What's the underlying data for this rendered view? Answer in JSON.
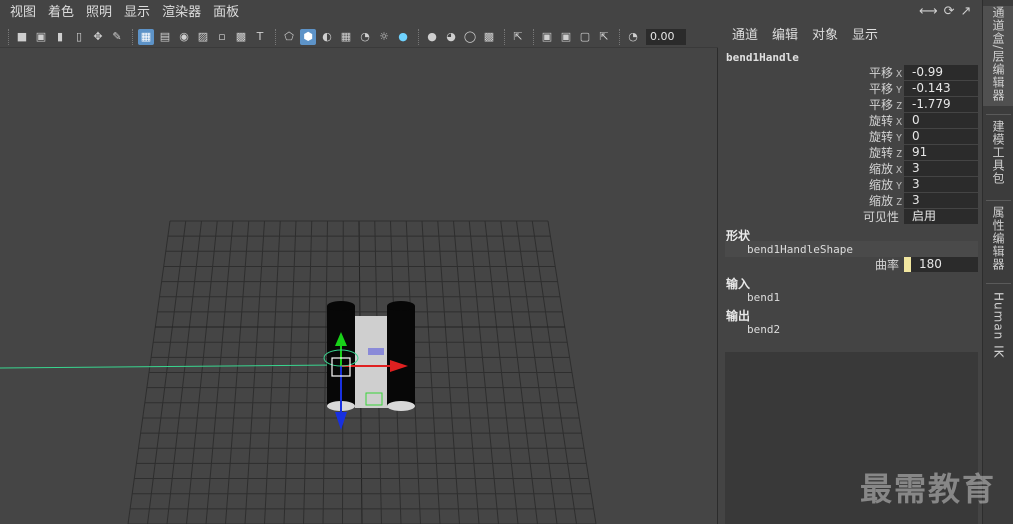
{
  "viewport": {
    "menus": [
      "视图",
      "着色",
      "照明",
      "显示",
      "渲染器",
      "面板"
    ],
    "toolbar_number": "0.00",
    "toolbar_icons": [
      "camera-icon",
      "camera-attributes-icon",
      "bookmark-icon",
      "image-plane-icon",
      "2d-pan-icon",
      "grease-pencil-icon",
      "grid-icon",
      "film-gate-icon",
      "resolution-gate-icon",
      "gate-mask-icon",
      "field-chart-icon",
      "safe-action-icon",
      "safe-title-icon",
      "wireframe-icon",
      "smooth-shade-icon",
      "default-material-icon",
      "textured-icon",
      "lights-icon",
      "shadows-icon",
      "screen-space-ao-icon",
      "motion-blur-icon",
      "anti-alias-icon",
      "depth-of-field-icon",
      "isolate-select-icon",
      "xray-icon",
      "xray-active-icon",
      "xray-joints-icon",
      "backface-icon",
      "exposure-icon"
    ]
  },
  "channel_box": {
    "top_icons": [
      "transform-axis-icon",
      "refresh-icon",
      "expand-icon"
    ],
    "menus": [
      "通道",
      "编辑",
      "对象",
      "显示"
    ],
    "node_name": "bend1Handle",
    "attributes": [
      {
        "label": "平移",
        "axis": "X",
        "value": "-0.99"
      },
      {
        "label": "平移",
        "axis": "Y",
        "value": "-0.143"
      },
      {
        "label": "平移",
        "axis": "Z",
        "value": "-1.779"
      },
      {
        "label": "旋转",
        "axis": "X",
        "value": "0"
      },
      {
        "label": "旋转",
        "axis": "Y",
        "value": "0"
      },
      {
        "label": "旋转",
        "axis": "Z",
        "value": "91"
      },
      {
        "label": "缩放",
        "axis": "X",
        "value": "3"
      },
      {
        "label": "缩放",
        "axis": "Y",
        "value": "3"
      },
      {
        "label": "缩放",
        "axis": "Z",
        "value": "3"
      },
      {
        "label": "可见性",
        "axis": "",
        "value": "启用"
      }
    ],
    "shapes_header": "形状",
    "shape_node": "bend1HandleShape",
    "curvature_label": "曲率",
    "curvature_value": "180",
    "inputs_header": "输入",
    "input_node": "bend1",
    "outputs_header": "输出",
    "output_node": "bend2"
  },
  "side_tabs": [
    "通道盒/层编辑器",
    "建模工具包",
    "属性编辑器",
    "Human IK"
  ],
  "watermark": "最需教育",
  "colors": {
    "selection_blue": "#5d93c8",
    "wire_green": "#39d68f",
    "axis_red": "#e02020",
    "axis_green": "#18d018",
    "axis_blue": "#1830e0"
  }
}
